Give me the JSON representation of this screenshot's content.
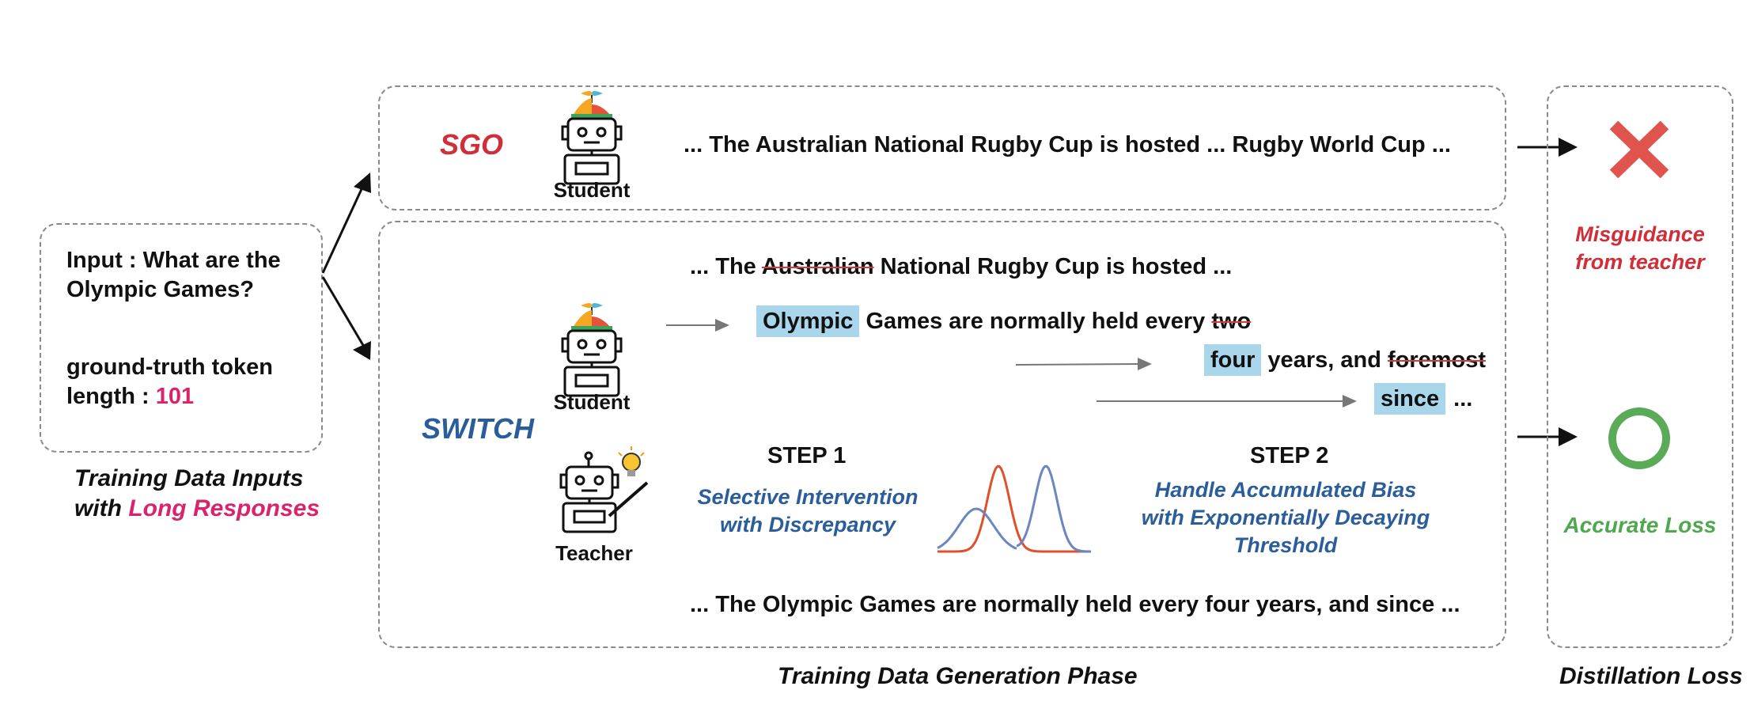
{
  "input_box": {
    "question": "Input : What are the Olympic Games?",
    "length_prefix": "ground-truth token length : ",
    "length_value": "101"
  },
  "left_caption": {
    "line1": "Training Data Inputs",
    "line2_prefix": "with ",
    "line2_highlight": "Long Responses"
  },
  "sgo": {
    "label": "SGO",
    "robot_label": "Student",
    "sentence": "... The Australian National Rugby Cup is hosted ... Rugby World Cup ..."
  },
  "switch": {
    "label": "SWITCH",
    "student_label": "Student",
    "teacher_label": "Teacher",
    "line_top": {
      "prefix": "... The ",
      "struck": "Australian",
      "suffix": " National Rugby Cup is hosted ..."
    },
    "line2": {
      "hl": "Olympic",
      "text": " Games are normally held every ",
      "struck": "two"
    },
    "line3": {
      "hl": "four",
      "text": " years, and ",
      "struck": "foremost"
    },
    "line4": {
      "hl": "since",
      "text": "..."
    },
    "step1": {
      "title": "STEP 1",
      "desc_line1": "Selective Intervention",
      "desc_line2": "with Discrepancy"
    },
    "step2": {
      "title": "STEP 2",
      "desc_line1": "Handle Accumulated Bias",
      "desc_line2": "with Exponentially Decaying",
      "desc_line3": "Threshold"
    },
    "final_sentence": "... The Olympic Games are normally held every four years, and since ..."
  },
  "middle_caption": "Training Data Generation Phase",
  "right": {
    "misguidance_line1": "Misguidance",
    "misguidance_line2": "from teacher",
    "accurate": "Accurate Loss",
    "caption": "Distillation Loss"
  },
  "colors": {
    "red": "#cf2f38",
    "pink": "#d9246b",
    "blue": "#2a5d9a",
    "green": "#4fa84f",
    "highlight": "#a9d6ea"
  }
}
